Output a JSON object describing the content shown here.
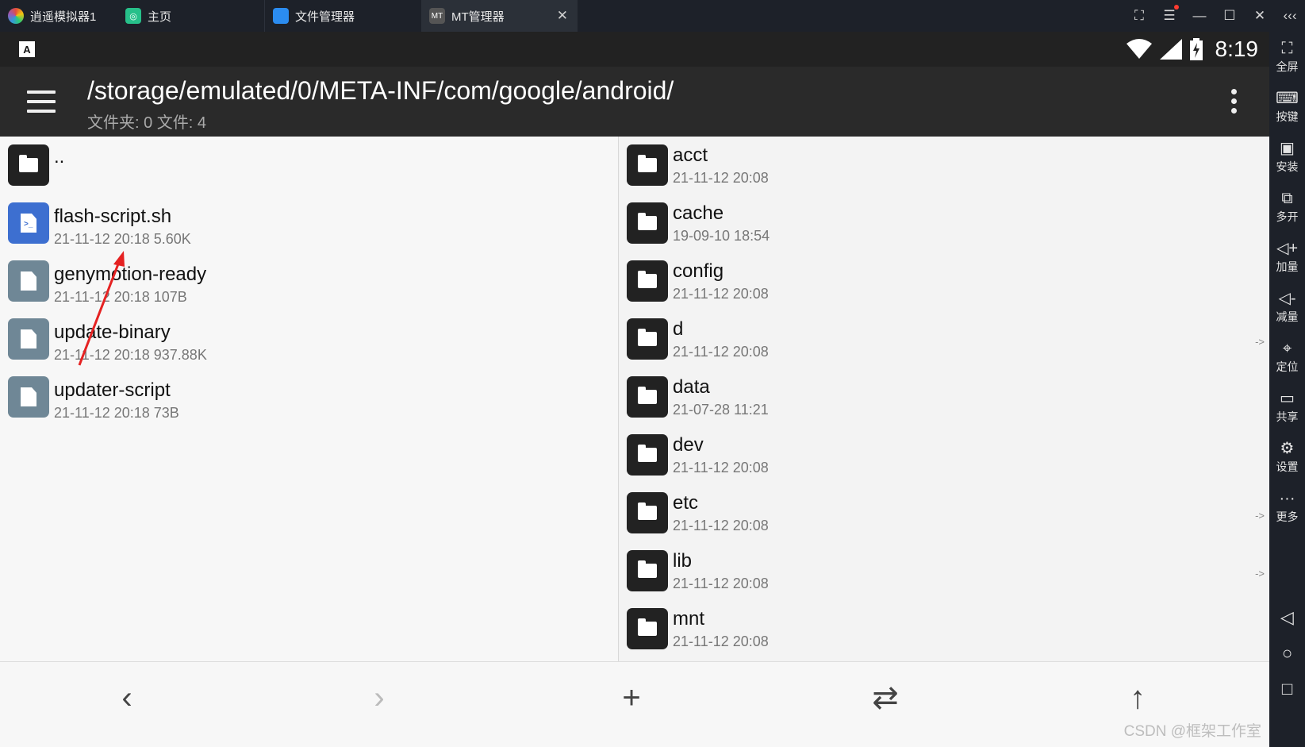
{
  "window": {
    "app_tab": "逍遥模拟器1",
    "home_tab": "主页",
    "fm_tab": "文件管理器",
    "mt_tab": "MT管理器",
    "mt_tab_icon": "MT"
  },
  "status": {
    "time": "8:19",
    "a_badge": "A"
  },
  "toolbar": {
    "path": "/storage/emulated/0/META-INF/com/google/android/",
    "summary": "文件夹: 0  文件: 4"
  },
  "left_pane": {
    "up_label": "..",
    "files": [
      {
        "name": "flash-script.sh",
        "meta": "21-11-12 20:18  5.60K",
        "type": "script"
      },
      {
        "name": "genymotion-ready",
        "meta": "21-11-12 20:18  107B",
        "type": "file"
      },
      {
        "name": "update-binary",
        "meta": "21-11-12 20:18  937.88K",
        "type": "file"
      },
      {
        "name": "updater-script",
        "meta": "21-11-12 20:18  73B",
        "type": "file"
      }
    ]
  },
  "right_pane": {
    "folders": [
      {
        "name": "acct",
        "meta": "21-11-12 20:08",
        "link": ""
      },
      {
        "name": "cache",
        "meta": "19-09-10 18:54",
        "link": ""
      },
      {
        "name": "config",
        "meta": "21-11-12 20:08",
        "link": ""
      },
      {
        "name": "d",
        "meta": "21-11-12 20:08",
        "link": "->"
      },
      {
        "name": "data",
        "meta": "21-07-28 11:21",
        "link": ""
      },
      {
        "name": "dev",
        "meta": "21-11-12 20:08",
        "link": ""
      },
      {
        "name": "etc",
        "meta": "21-11-12 20:08",
        "link": "->"
      },
      {
        "name": "lib",
        "meta": "21-11-12 20:08",
        "link": "->"
      },
      {
        "name": "mnt",
        "meta": "21-11-12 20:08",
        "link": ""
      }
    ]
  },
  "bottom": {
    "back": "‹",
    "forward": "›",
    "add": "+",
    "swap": "⇄",
    "up": "↑",
    "watermark": "CSDN @框架工作室"
  },
  "sidebar": {
    "items": [
      {
        "icon": "⛶",
        "label": "全屏"
      },
      {
        "icon": "⌨",
        "label": "按键"
      },
      {
        "icon": "▣",
        "label": "安装"
      },
      {
        "icon": "⧉",
        "label": "多开"
      },
      {
        "icon": "◁+",
        "label": "加量"
      },
      {
        "icon": "◁-",
        "label": "减量"
      },
      {
        "icon": "⌖",
        "label": "定位"
      },
      {
        "icon": "▭",
        "label": "共享"
      },
      {
        "icon": "⚙",
        "label": "设置"
      },
      {
        "icon": "···",
        "label": "更多"
      }
    ],
    "nav_back": "◁",
    "nav_home": "○",
    "nav_recent": "□",
    "top_chevrons": "‹‹‹"
  }
}
